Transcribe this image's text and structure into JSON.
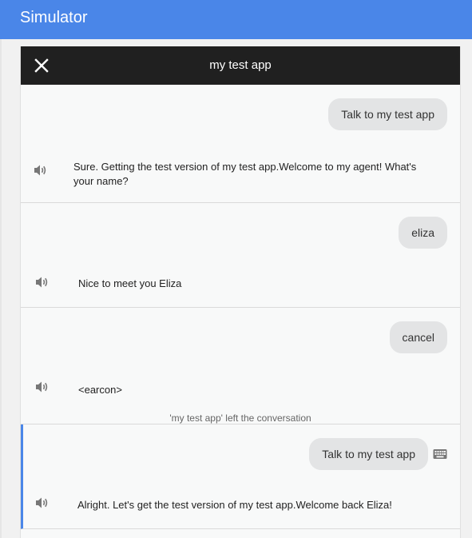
{
  "app": {
    "title": "Simulator"
  },
  "simulator": {
    "header_title": "my test app",
    "turns": [
      {
        "user": "Talk to my test app",
        "agent": "Sure. Getting the test version of my test app.Welcome to my agent! What's your name?"
      },
      {
        "user": "eliza",
        "agent": "Nice to meet you Eliza"
      },
      {
        "user": "cancel",
        "agent": "<earcon>",
        "note": "'my test app' left the conversation"
      },
      {
        "user": "Talk to my test app",
        "agent": "Alright. Let's get the test version of my test app.Welcome back Eliza!"
      }
    ]
  },
  "icons": {
    "close": "close-icon",
    "speaker": "speaker-icon",
    "keyboard": "keyboard-icon"
  },
  "colors": {
    "topbar": "#4a86e8",
    "panel_header": "#202020",
    "bubble": "#e3e4e5",
    "active_indicator": "#4a86e8"
  }
}
